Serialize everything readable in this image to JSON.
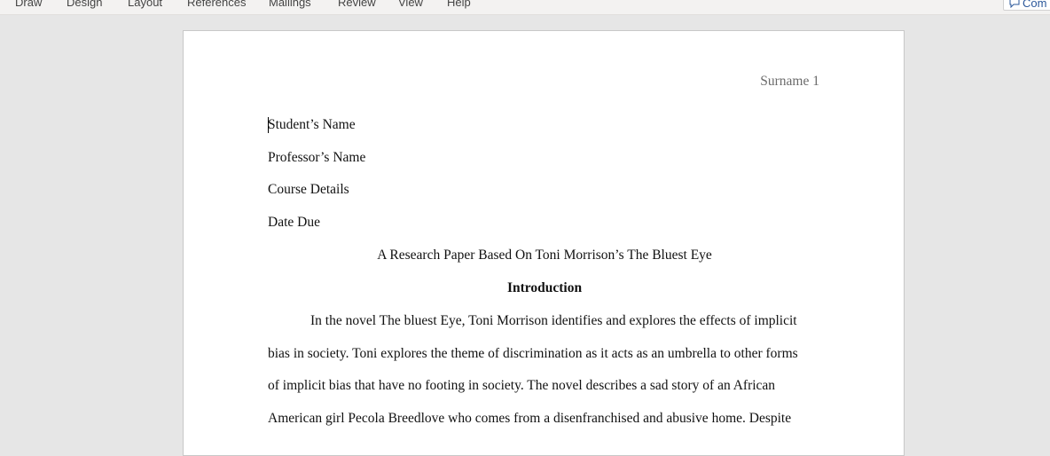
{
  "ribbon": {
    "tabs": [
      "Draw",
      "Design",
      "Layout",
      "References",
      "Mailings",
      "Review",
      "View",
      "Help"
    ],
    "comments_label": "Com"
  },
  "document": {
    "header": "Surname 1",
    "student_name": "Student’s Name",
    "professor_name": "Professor’s Name",
    "course_details": "Course Details",
    "date_due": "Date Due",
    "title": "A Research Paper Based On Toni Morrison’s The Bluest Eye",
    "section_heading": "Introduction",
    "body_lines": [
      "In the novel The bluest Eye, Toni Morrison identifies and explores the effects of implicit",
      "bias in society. Toni explores the theme of discrimination as it acts as an umbrella to other forms",
      "of implicit bias that have no footing in society. The novel describes a sad story of an African",
      "American girl Pecola Breedlove who comes from a disenfranchised and abusive home. Despite"
    ]
  }
}
